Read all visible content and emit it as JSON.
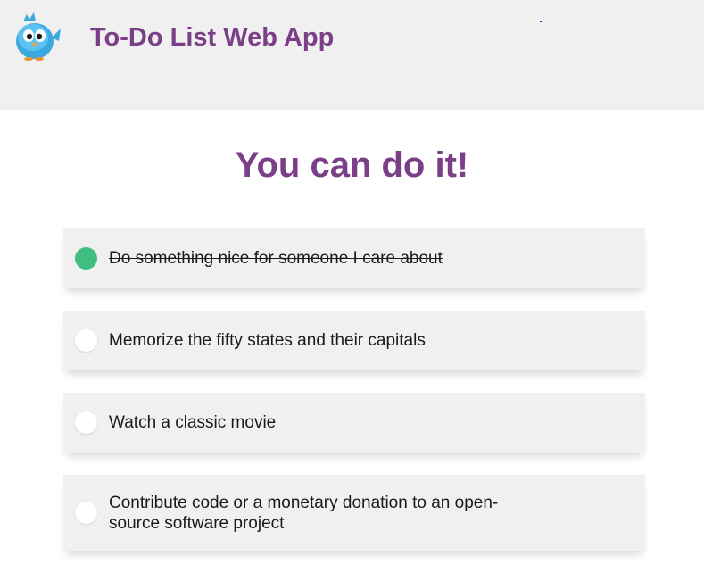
{
  "header": {
    "title": "To-Do List Web App",
    "logo_icon": "blue-bird-icon"
  },
  "main": {
    "heading": "You can do it!"
  },
  "todos": [
    {
      "text": "Do something nice for someone I care about",
      "completed": true
    },
    {
      "text": "Memorize the fifty states and their capitals",
      "completed": false
    },
    {
      "text": "Watch a classic movie",
      "completed": false
    },
    {
      "text": "Contribute code or a monetary donation to an open-source software project",
      "completed": false
    }
  ],
  "colors": {
    "accent": "#7a3f86",
    "done": "#3fbf7f",
    "header_bg": "#f0f0f0",
    "item_bg": "#f0f0f0"
  }
}
